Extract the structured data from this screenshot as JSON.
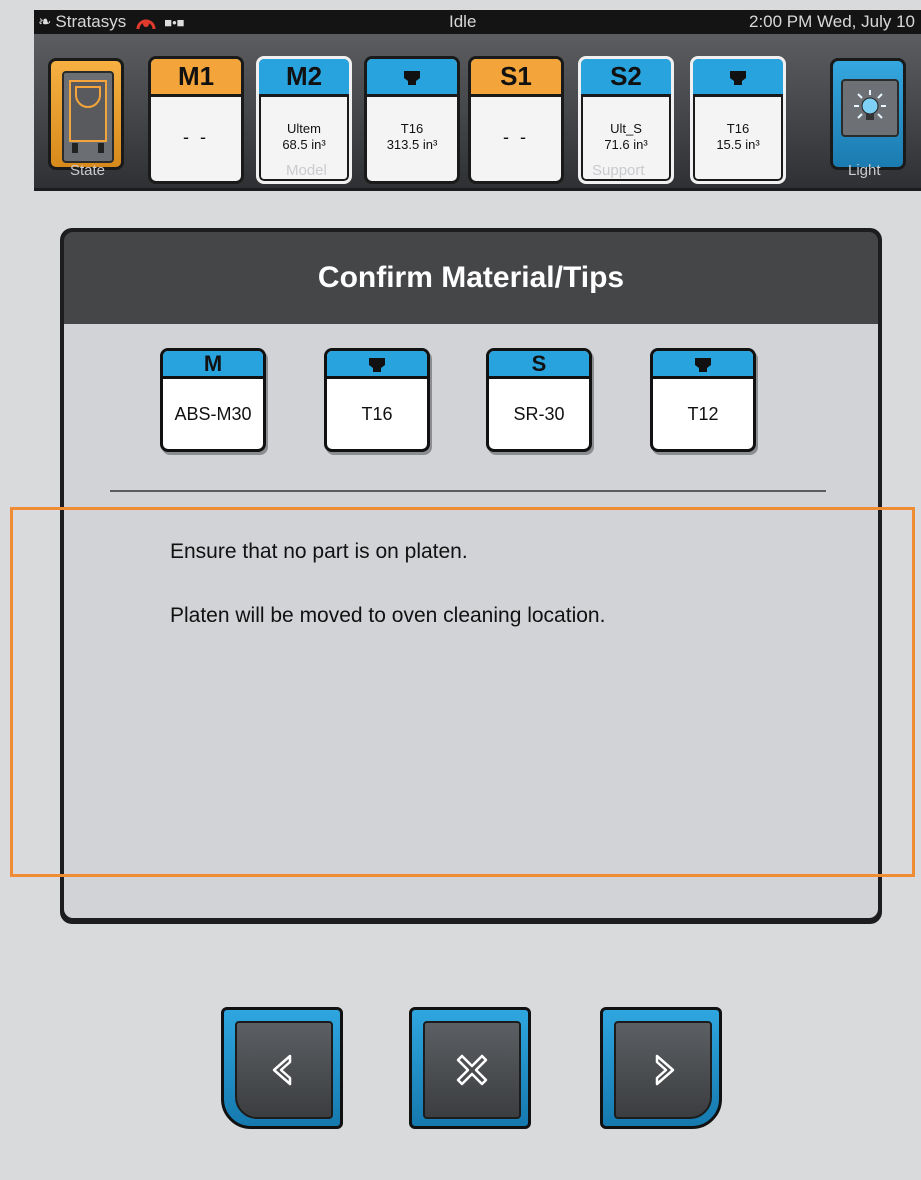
{
  "statusbar": {
    "brand": "Stratasys",
    "status": "Idle",
    "datetime": "2:00 PM Wed, July 10"
  },
  "toolbar": {
    "state_label": "State",
    "model_label": "Model",
    "support_label": "Support",
    "light_label": "Light",
    "bays": [
      {
        "cap": "M1",
        "line1": "- -",
        "line2": ""
      },
      {
        "cap": "M2",
        "line1": "Ultem",
        "line2": "68.5 in³"
      },
      {
        "cap": "",
        "line1": "T16",
        "line2": "313.5 in³"
      },
      {
        "cap": "S1",
        "line1": "- -",
        "line2": ""
      },
      {
        "cap": "S2",
        "line1": "Ult_S",
        "line2": "71.6 in³"
      },
      {
        "cap": "",
        "line1": "T16",
        "line2": "15.5 in³"
      }
    ]
  },
  "dialog": {
    "title": "Confirm Material/Tips",
    "materials": [
      {
        "cap": "M",
        "value": "ABS-M30"
      },
      {
        "cap": "",
        "value": "T16"
      },
      {
        "cap": "S",
        "value": "SR-30"
      },
      {
        "cap": "",
        "value": "T12"
      }
    ],
    "message_1": "Ensure that no part is on platen.",
    "message_2": "Platen will be moved to oven cleaning location."
  },
  "colors": {
    "orange": "#f3a43a",
    "blue": "#29a3de",
    "highlight": "#f08c34"
  }
}
